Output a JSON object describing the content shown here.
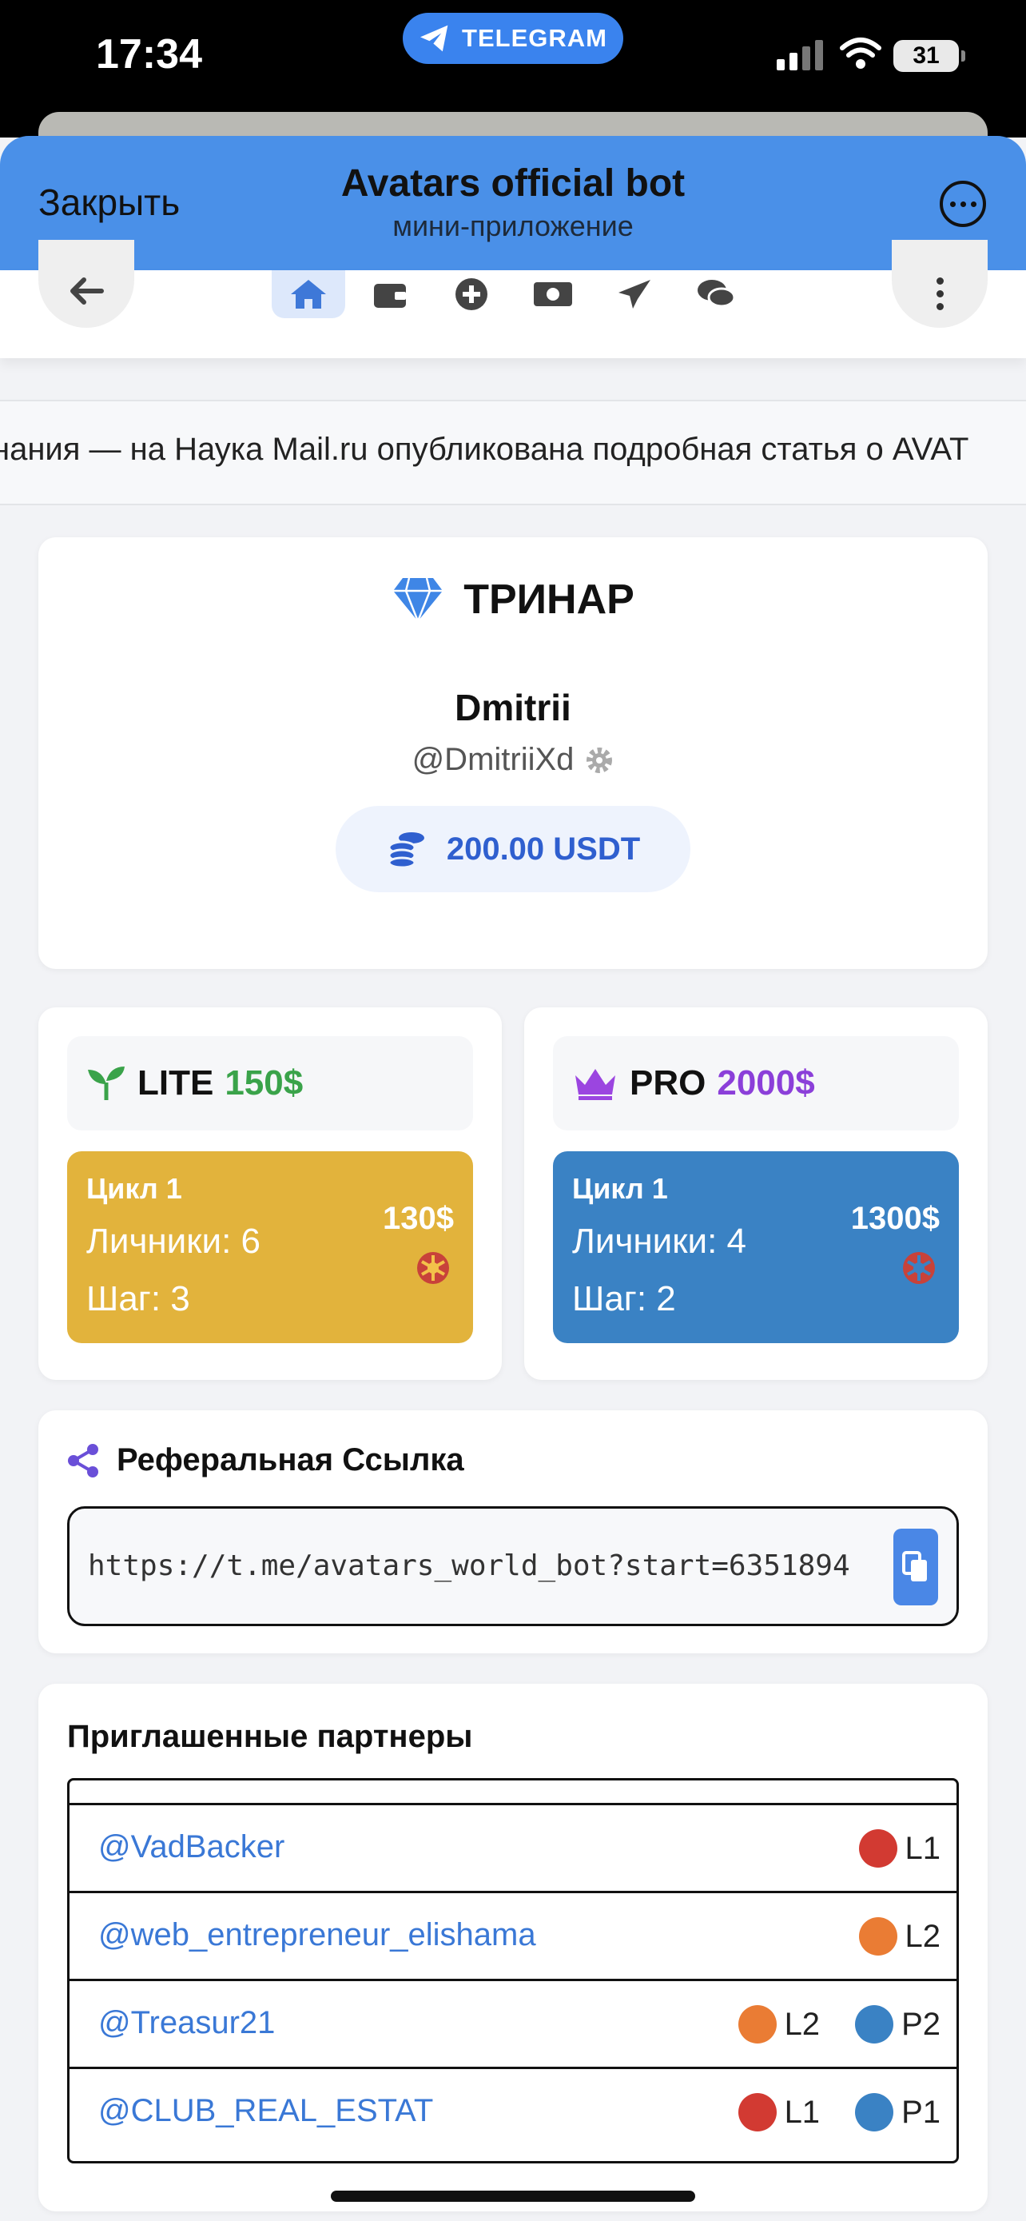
{
  "status_bar": {
    "time": "17:34",
    "pill_label": "TELEGRAM",
    "battery": "31"
  },
  "header": {
    "close_label": "Закрыть",
    "title": "Avatars official bot",
    "subtitle": "мини-приложение"
  },
  "ticker": {
    "text": "нания — на Наука Mail.ru опубликована подробная статья о AVAT"
  },
  "profile": {
    "rank": "ТРИНАР",
    "name": "Dmitrii",
    "handle": "@DmitriiXd",
    "balance": "200.00 USDT"
  },
  "plans": [
    {
      "name": "LITE",
      "price": "150$",
      "price_color": "#3aa34a",
      "cycle": "Цикл 1",
      "personal": "Личники: 6",
      "step": "Шаг: 3",
      "amount": "130$",
      "card_color": "#e2b33c"
    },
    {
      "name": "PRO",
      "price": "2000$",
      "price_color": "#8b3fd9",
      "cycle": "Цикл 1",
      "personal": "Личники: 4",
      "step": "Шаг: 2",
      "amount": "1300$",
      "card_color": "#3a82c4"
    }
  ],
  "referral": {
    "title": "Реферальная Ссылка",
    "link": "https://t.me/avatars_world_bot?start=6351894"
  },
  "partners": {
    "title": "Приглашенные партнеры",
    "rows": [
      {
        "name": "@VadBacker",
        "badges": [
          {
            "label": "L1",
            "color": "#d23a32"
          }
        ]
      },
      {
        "name": "@web_entrepreneur_elishama",
        "badges": [
          {
            "label": "L2",
            "color": "#ea7c34"
          }
        ]
      },
      {
        "name": "@Treasur21",
        "badges": [
          {
            "label": "L2",
            "color": "#ea7c34"
          },
          {
            "label": "P2",
            "color": "#3a82c4"
          }
        ]
      },
      {
        "name": "@CLUB_REAL_ESTAT",
        "badges": [
          {
            "label": "L1",
            "color": "#d23a32"
          },
          {
            "label": "P1",
            "color": "#3a82c4"
          }
        ]
      }
    ]
  },
  "colors": {
    "telegram_blue": "#4a90e8",
    "accent": "#2f5fcf",
    "link": "#3a78d6"
  }
}
